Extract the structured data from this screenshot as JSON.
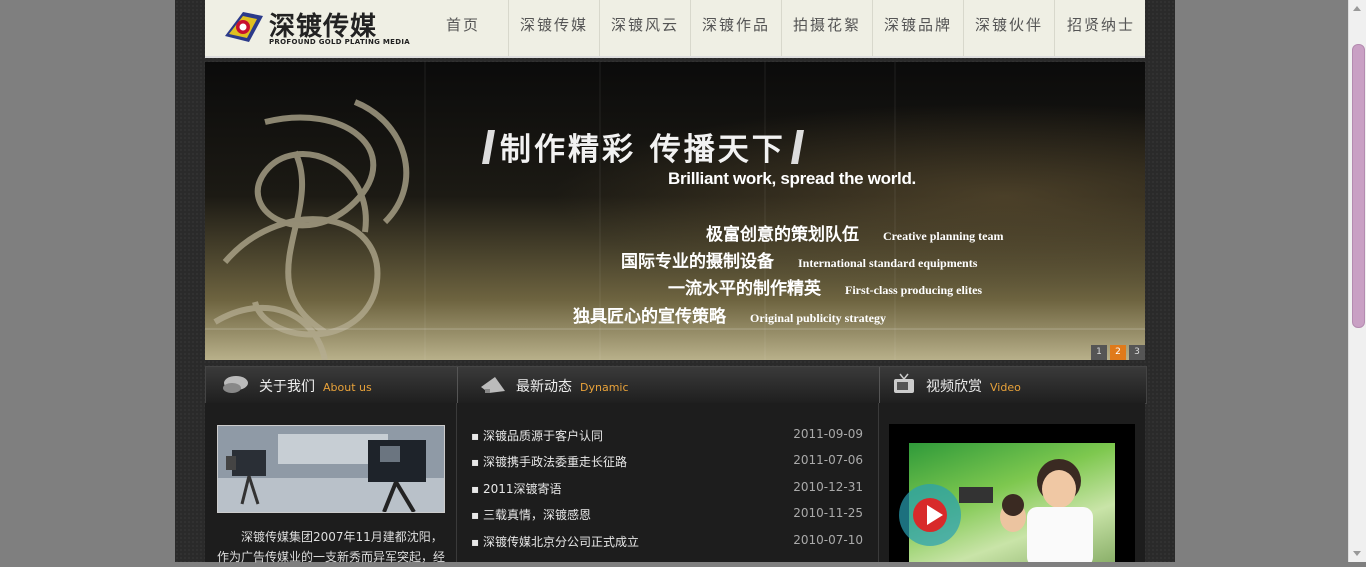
{
  "logo": {
    "name_cn": "深镀传媒",
    "name_en": "PROFOUND GOLD PLATING MEDIA",
    "icon": "gold-plating-logo-icon"
  },
  "nav": {
    "items": [
      "首页",
      "深镀传媒",
      "深镀风云",
      "深镀作品",
      "拍摄花絮",
      "深镀品牌",
      "深镀伙伴",
      "招贤纳士"
    ]
  },
  "banner": {
    "headline": "制作精彩  传播天下",
    "subline": "Brilliant work, spread the world.",
    "features": [
      {
        "cn": "极富创意的策划队伍",
        "en": "Creative planning team"
      },
      {
        "cn": "国际专业的摄制设备",
        "en": "International standard equipments"
      },
      {
        "cn": "一流水平的制作精英",
        "en": "First-class producing elites"
      },
      {
        "cn": "独具匠心的宣传策略",
        "en": "Original publicity strategy"
      }
    ],
    "pager": [
      "1",
      "2",
      "3"
    ],
    "pager_active": "2"
  },
  "sections": {
    "about": {
      "cn": "关于我们",
      "en": "About us",
      "icon": "chat-bubble-icon"
    },
    "news": {
      "cn": "最新动态",
      "en": "Dynamic",
      "icon": "megaphone-icon"
    },
    "video": {
      "cn": "视频欣赏",
      "en": "Video",
      "icon": "tv-icon"
    }
  },
  "about": {
    "image": "tv-studio-camera-image",
    "text": "深镀传媒集团2007年11月建都沈阳，作为广告传媒业的一支新秀而异军突起，经"
  },
  "news": {
    "items": [
      {
        "title": "深镀品质源于客户认同",
        "date": "2011-09-09"
      },
      {
        "title": "深镀携手政法委重走长征路",
        "date": "2011-07-06"
      },
      {
        "title": "2011深镀寄语",
        "date": "2010-12-31"
      },
      {
        "title": "三载真情，深镀感恩",
        "date": "2010-11-25"
      },
      {
        "title": "深镀传媒北京分公司正式成立",
        "date": "2010-07-10"
      }
    ]
  },
  "video": {
    "thumbnail": "video-thumbnail-image",
    "play_icon": "play-icon"
  },
  "colors": {
    "accent": "#e8a23a",
    "pager_active": "#e07a1a",
    "header_bg": "#efefe4",
    "scroll_thumb": "#c9a0c4"
  }
}
